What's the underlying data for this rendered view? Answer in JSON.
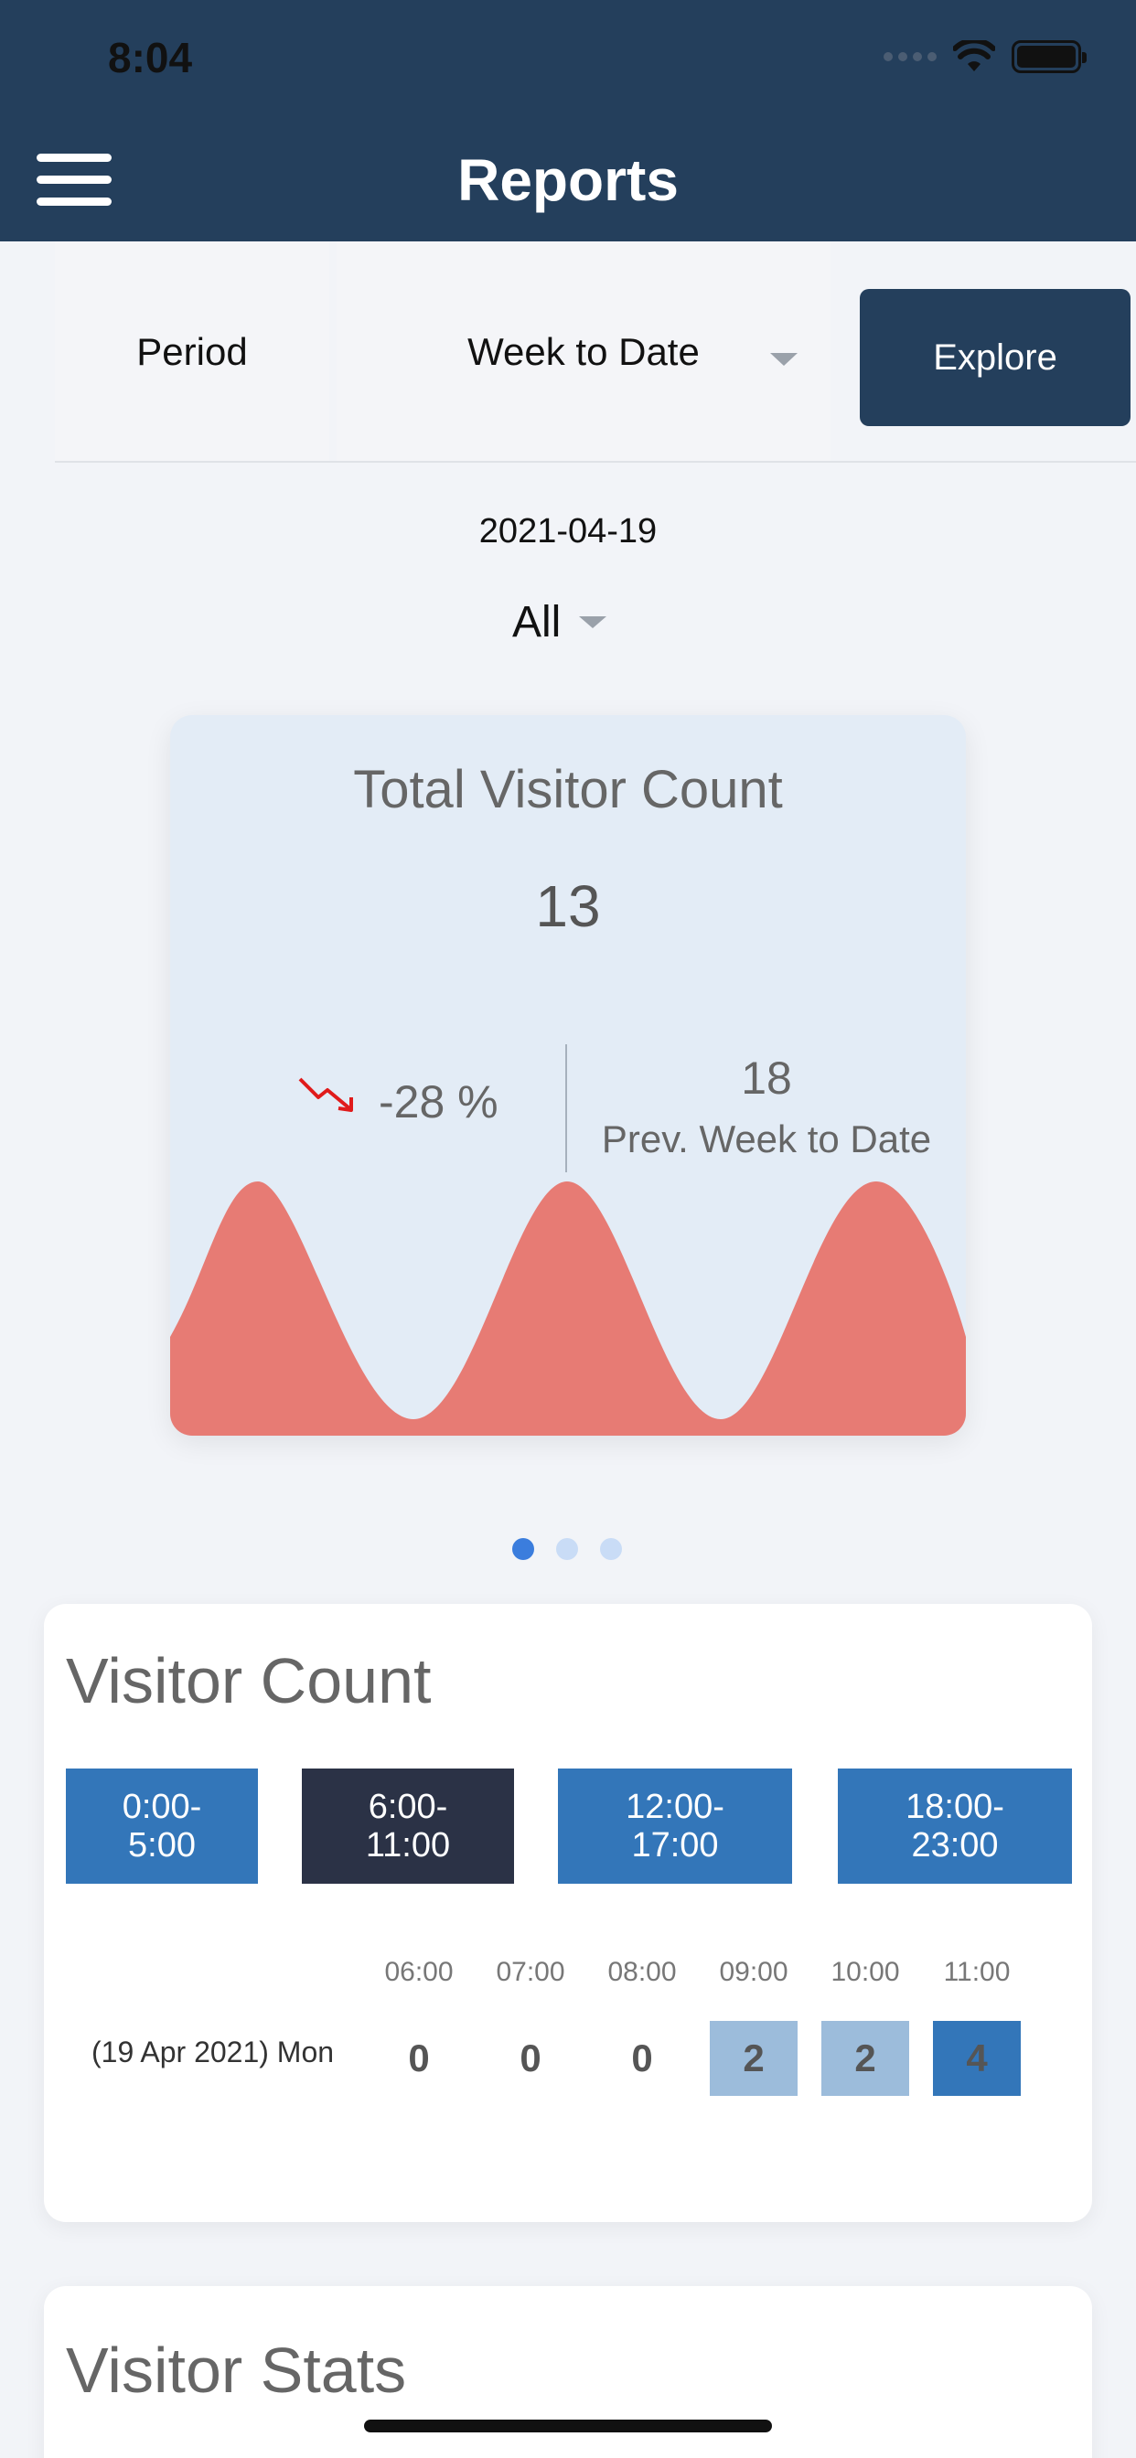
{
  "status_bar": {
    "time": "8:04"
  },
  "header": {
    "title": "Reports"
  },
  "filters": {
    "period_label": "Period",
    "period_value": "Week to Date",
    "explore_label": "Explore",
    "date": "2021-04-19",
    "scope_value": "All"
  },
  "summary_card": {
    "title": "Total Visitor Count",
    "count": "13",
    "change": "-28 %",
    "prev_count": "18",
    "prev_label": "Prev. Week to Date",
    "trend_color": "#e01b1b",
    "wave_color": "#e77b74"
  },
  "pager": {
    "pages": 3,
    "active": 0
  },
  "visitor_count": {
    "title": "Visitor Count",
    "ranges": [
      {
        "label": "0:00-\n5:00",
        "selected": false
      },
      {
        "label": "6:00-\n11:00",
        "selected": true
      },
      {
        "label": "12:00-\n17:00",
        "selected": false
      },
      {
        "label": "18:00-\n23:00",
        "selected": false
      }
    ],
    "hours": [
      "06:00",
      "07:00",
      "08:00",
      "09:00",
      "10:00",
      "11:00"
    ],
    "row_label": "(19 Apr 2021) Mon",
    "values": [
      "0",
      "0",
      "0",
      "2",
      "2",
      "4"
    ]
  },
  "visitor_stats": {
    "title": "Visitor Stats"
  }
}
